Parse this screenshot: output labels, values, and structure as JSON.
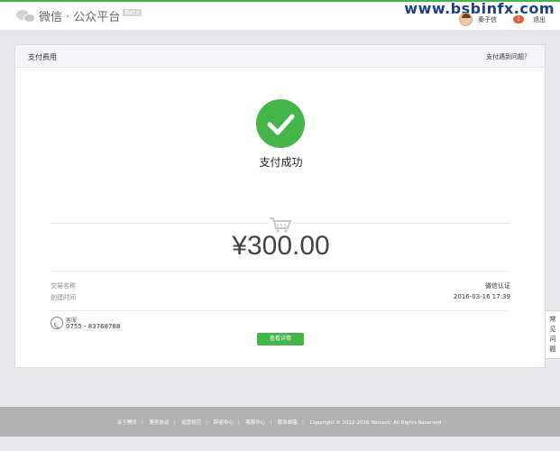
{
  "header": {
    "logo_text": "微信 · 公众平台",
    "beta_badge": "Beta",
    "watermark": "www.bsbinfx.com",
    "username": "秦子信",
    "notification_count": "1",
    "logout_label": "退出"
  },
  "card": {
    "title": "支付费用",
    "help_link": "支付遇到问题？",
    "status_text": "支付成功",
    "amount": "¥300.00",
    "details": [
      {
        "label": "交易名称",
        "value": "微信认证"
      },
      {
        "label": "创建时间",
        "value": "2016-03-16 17:39"
      }
    ],
    "service_label": "客服",
    "service_phone": "0755 - 83768788",
    "detail_button": "查看详情"
  },
  "side_tab": {
    "chars": [
      "常",
      "见",
      "问",
      "题"
    ]
  },
  "footer": {
    "links": [
      "关于腾讯",
      "服务协议",
      "运营规范",
      "辟谣中心",
      "客服中心",
      "联系邮箱"
    ],
    "copyright": "Copyright © 2012-2016 Tencent. All Rights Reserved."
  },
  "colors": {
    "accent": "#44b549",
    "badge": "#e0613b",
    "footer": "#b2b2b2"
  }
}
